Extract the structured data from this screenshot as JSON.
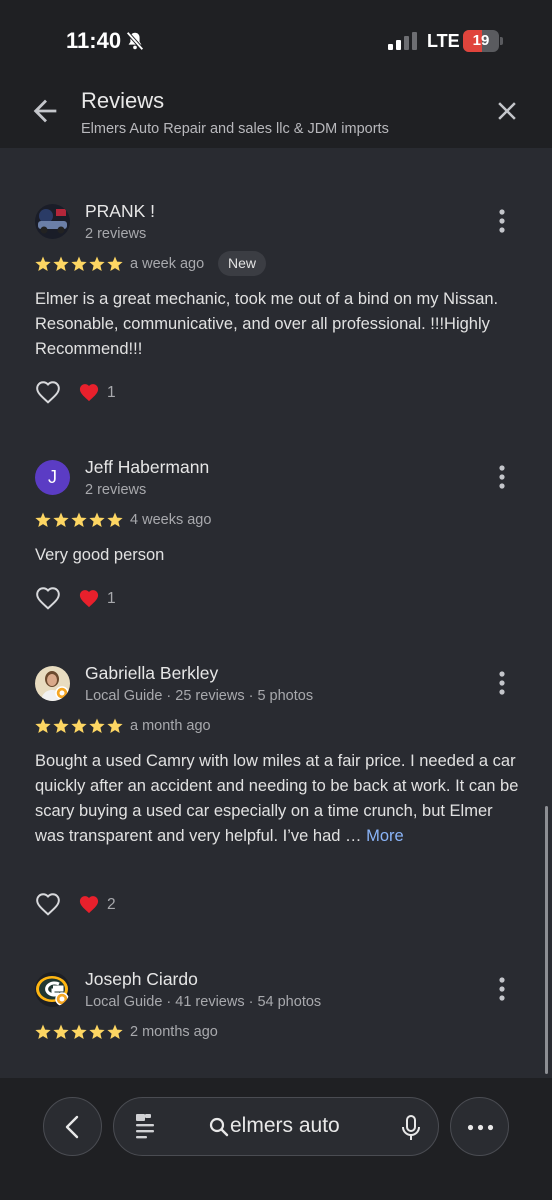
{
  "status_bar": {
    "time": "11:40",
    "network": "LTE",
    "battery_level": "19",
    "battery_color": "#e0443c"
  },
  "header": {
    "title": "Reviews",
    "subtitle": "Elmers Auto Repair and sales llc & JDM imports"
  },
  "reviews": [
    {
      "name": "PRANK !",
      "meta": "2 reviews",
      "rating": 5,
      "time": "a week ago",
      "badge": "New",
      "text": "Elmer is a great mechanic, took me out of a bind on my Nissan. Resonable, communicative, and over all professional. !!!Highly Recommend!!!",
      "reactions": "1"
    },
    {
      "name": "Jeff Habermann",
      "avatar_letter": "J",
      "avatar_color": "#5b3cc4",
      "meta": "2 reviews",
      "rating": 5,
      "time": "4 weeks ago",
      "text": "Very good person",
      "reactions": "1"
    },
    {
      "name": "Gabriella Berkley",
      "meta": "Local Guide · 25 reviews · 5 photos",
      "rating": 5,
      "time": "a month ago",
      "text": "Bought a used Camry with low miles at a fair price. I needed a car quickly after an accident and needing to be back at work. It can be scary buying a used car especially on a time crunch, but Elmer was transparent and very helpful. I’ve had …",
      "more_label": "More",
      "reactions": "2"
    },
    {
      "name": "Joseph Ciardo",
      "meta": "Local Guide · 41 reviews · 54 photos",
      "rating": 5,
      "time": "2 months ago"
    }
  ],
  "bottom_bar": {
    "query": "elmers auto"
  },
  "colors": {
    "star": "#fdd663",
    "heart": "#e8202c",
    "link": "#8ab4f8"
  }
}
